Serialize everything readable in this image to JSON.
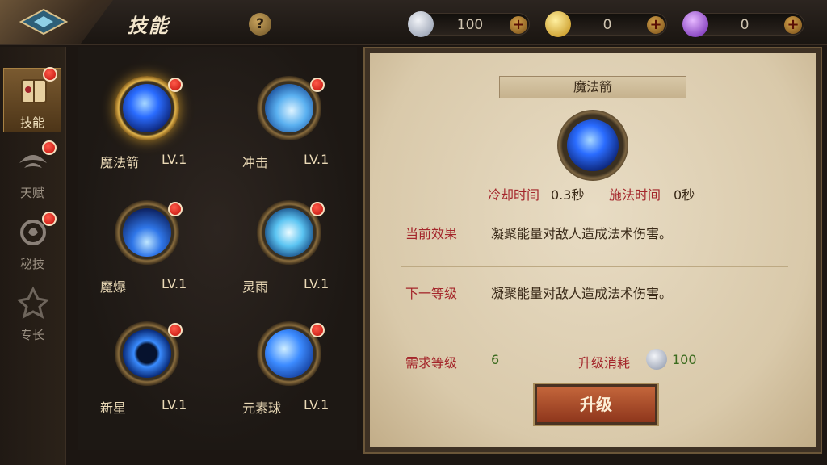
{
  "header": {
    "title": "技能",
    "help_label": "?",
    "currencies": [
      {
        "name": "silver",
        "value": "100",
        "plus": "+",
        "color": "#b9c4d6"
      },
      {
        "name": "gold",
        "value": "0",
        "plus": "+",
        "color": "#e2b52a"
      },
      {
        "name": "crystal",
        "value": "0",
        "plus": "+",
        "color": "#9a4fd6"
      }
    ]
  },
  "sidenav": {
    "items": [
      {
        "label": "技能",
        "icon": "skill-book-icon",
        "active": true,
        "badge": true
      },
      {
        "label": "天赋",
        "icon": "talent-icon",
        "active": false,
        "badge": true
      },
      {
        "label": "秘技",
        "icon": "secret-art-icon",
        "active": false,
        "badge": true
      },
      {
        "label": "专长",
        "icon": "specialty-icon",
        "active": false,
        "badge": false
      }
    ]
  },
  "skills": [
    {
      "name": "魔法箭",
      "level": "LV.1",
      "icon": "magic-arrow-icon",
      "selected": true
    },
    {
      "name": "冲击",
      "level": "LV.1",
      "icon": "impact-icon",
      "selected": false
    },
    {
      "name": "魔爆",
      "level": "LV.1",
      "icon": "magic-burst-icon",
      "selected": false
    },
    {
      "name": "灵雨",
      "level": "LV.1",
      "icon": "spirit-rain-icon",
      "selected": false
    },
    {
      "name": "新星",
      "level": "LV.1",
      "icon": "nova-icon",
      "selected": false
    },
    {
      "name": "元素球",
      "level": "LV.1",
      "icon": "element-orb-icon",
      "selected": false
    }
  ],
  "detail": {
    "skill_name": "魔法箭",
    "cooldown_label": "冷却时间",
    "cooldown_value": "0.3秒",
    "cast_label": "施法时间",
    "cast_value": "0秒",
    "current_effect_label": "当前效果",
    "current_effect_text": "凝聚能量对敌人造成法术伤害。",
    "next_level_label": "下一等级",
    "next_level_text": "凝聚能量对敌人造成法术伤害。",
    "required_level_label": "需求等级",
    "required_level_value": "6",
    "upgrade_cost_label": "升级消耗",
    "upgrade_cost_value": "100",
    "upgrade_button": "升级"
  },
  "colors": {
    "accent_red": "#a4262b",
    "accent_green": "#3b6b1e",
    "skill_blue": "#2a6cff"
  }
}
